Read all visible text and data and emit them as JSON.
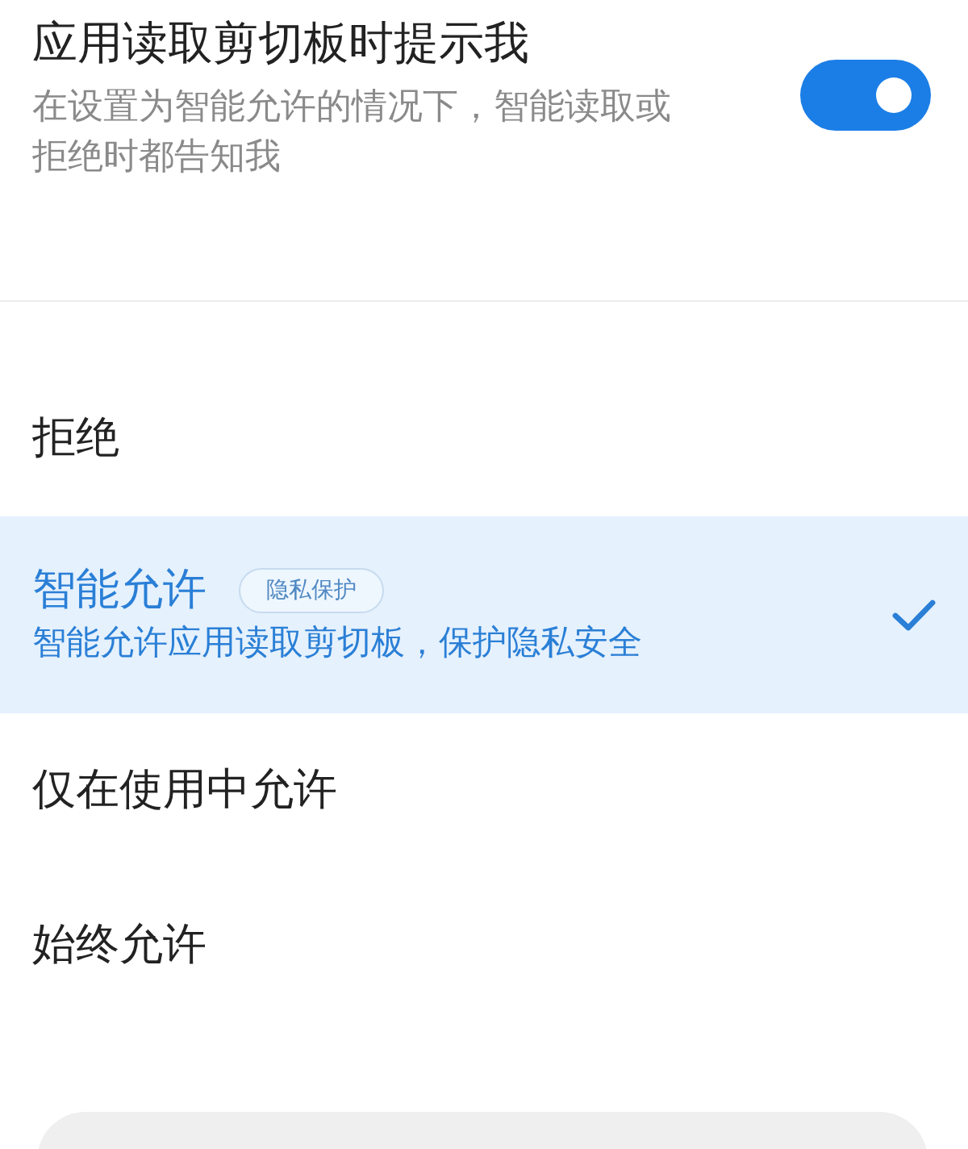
{
  "setting": {
    "title": "应用读取剪切板时提示我",
    "description": "在设置为智能允许的情况下，智能读取或拒绝时都告知我",
    "on": true
  },
  "options": [
    {
      "label": "拒绝",
      "selected": false
    },
    {
      "label": "智能允许",
      "badge": "隐私保护",
      "description": "智能允许应用读取剪切板，保护隐私安全",
      "selected": true
    },
    {
      "label": "仅在使用中允许",
      "selected": false
    },
    {
      "label": "始终允许",
      "selected": false
    }
  ]
}
